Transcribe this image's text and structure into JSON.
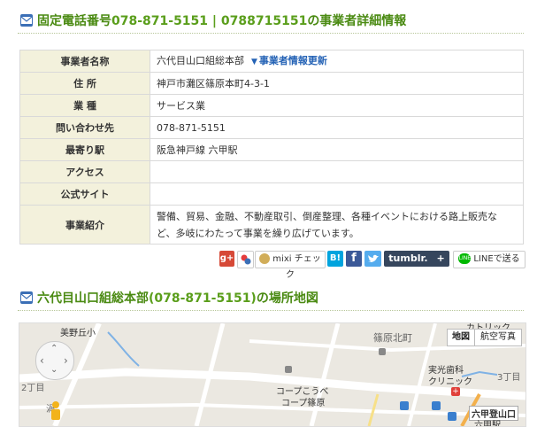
{
  "header1": {
    "prefix": "固定電話番号",
    "phones": "078-871-5151 | 0788715151",
    "suffix": "の事業者詳細情報"
  },
  "info": {
    "rows": [
      {
        "label": "事業者名称",
        "value": "六代目山口組総本部"
      },
      {
        "label": "住 所",
        "value": "神戸市灘区篠原本町4-3-1"
      },
      {
        "label": "業 種",
        "value": "サービス業"
      },
      {
        "label": "問い合わせ先",
        "value": "078-871-5151"
      },
      {
        "label": "最寄り駅",
        "value": "阪急神戸線 六甲駅"
      },
      {
        "label": "アクセス",
        "value": ""
      },
      {
        "label": "公式サイト",
        "value": ""
      },
      {
        "label": "事業紹介",
        "value": "警備、貿易、金融、不動産取引、倒産整理、各種イベントにおける路上販売など、多岐にわたって事業を繰り広げています。"
      }
    ],
    "update_link": "事業者情報更新"
  },
  "share": {
    "gplus": "g+",
    "mixi": "mixi チェック",
    "hatena": "B!",
    "facebook": "f",
    "tumblr": "tumblr.",
    "tumblr_plus": "+",
    "line": "LINEで送る"
  },
  "header2": {
    "name": "六代目山口組総本部",
    "phone": "(078-871-5151)",
    "suffix": "の場所地図"
  },
  "map": {
    "type_map": "地図",
    "type_satellite": "航空写真",
    "labels": {
      "mino": "美野丘小",
      "shinohara_kitamachi": "篠原北町",
      "chome2": "2丁目",
      "chome3": "3丁目",
      "catholic": "カトリック",
      "dental": "実光歯科",
      "clinic": "クリニック",
      "coop_kobe": "コープこうべ",
      "coop_shinohara": "コープ篠原",
      "rokko_tozan": "六甲登山口",
      "rokko_station": "六甲駅",
      "kan": "渦"
    }
  },
  "colors": {
    "accent_green": "#5a9e1b",
    "link_blue": "#2462b5",
    "th_bg": "#f3f1dc"
  }
}
